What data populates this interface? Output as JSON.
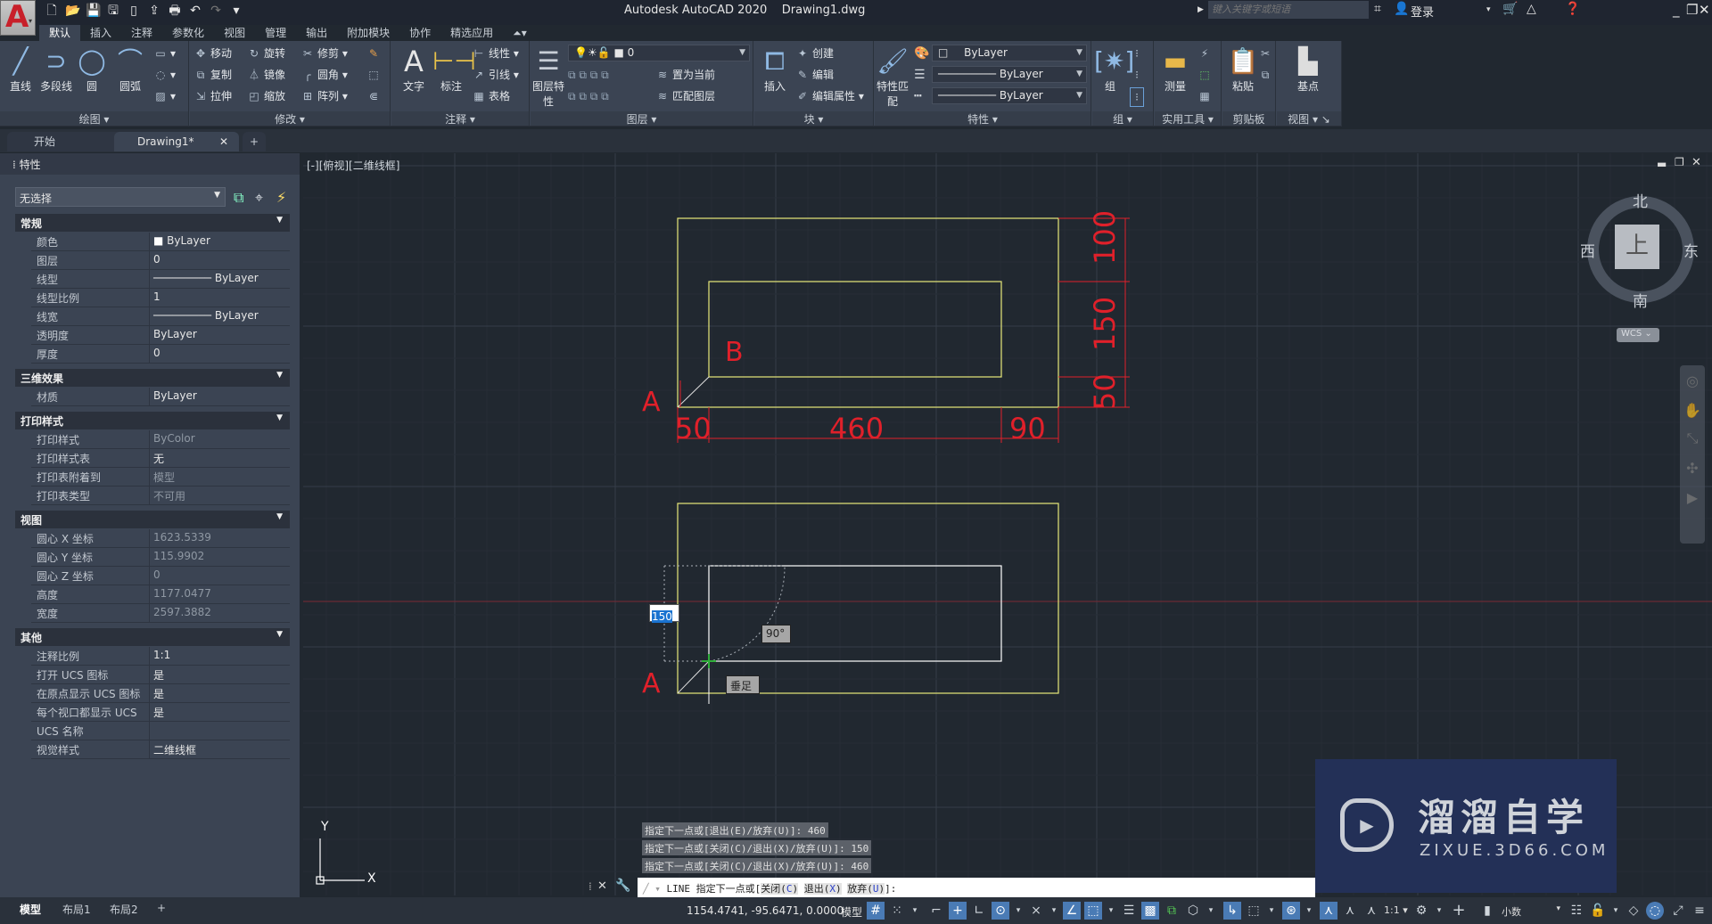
{
  "titlebar": {
    "app_logo": "A",
    "title": "Autodesk AutoCAD 2020    Drawing1.dwg",
    "search_placeholder": "键入关键字或短语",
    "login_label": "登录",
    "quick_access": [
      "new-icon",
      "open-icon",
      "save-icon",
      "save-as-icon",
      "open-web-icon",
      "save-web-icon",
      "plot-icon",
      "undo-icon",
      "redo-icon",
      "customize-icon"
    ]
  },
  "ribbon": {
    "tabs": [
      "默认",
      "插入",
      "注释",
      "参数化",
      "视图",
      "管理",
      "输出",
      "附加模块",
      "协作",
      "精选应用"
    ],
    "active_tab": "默认",
    "draw": {
      "title": "绘图",
      "line": "直线",
      "polyline": "多段线",
      "circle": "圆",
      "arc": "圆弧"
    },
    "modify": {
      "title": "修改",
      "move": "移动",
      "rotate": "旋转",
      "trim": "修剪",
      "copy": "复制",
      "mirror": "镜像",
      "fillet": "圆角",
      "stretch": "拉伸",
      "scale": "缩放",
      "array": "阵列"
    },
    "annotation": {
      "title": "注释",
      "text": "文字",
      "dimension": "标注",
      "linear": "线性",
      "leader": "引线",
      "table": "表格"
    },
    "layers": {
      "title": "图层",
      "layer_props": "图层特性",
      "layer_value": "0",
      "set_current": "置为当前",
      "match_layer": "匹配图层"
    },
    "block": {
      "title": "块",
      "insert": "插入",
      "create": "创建",
      "edit": "编辑",
      "edit_attr": "编辑属性"
    },
    "properties": {
      "title": "特性",
      "match": "特性匹配",
      "color": "ByLayer",
      "lineweight": "ByLayer",
      "linetype": "ByLayer"
    },
    "groups": {
      "title": "组",
      "group": "组"
    },
    "utilities": {
      "title": "实用工具",
      "measure": "测量"
    },
    "clipboard": {
      "title": "剪贴板",
      "paste": "粘贴"
    },
    "view": {
      "title": "视图",
      "base": "基点"
    }
  },
  "doc_tabs": {
    "start": "开始",
    "drawing": "Drawing1*"
  },
  "properties_panel": {
    "title": "特性",
    "selection": "无选择",
    "sections": [
      {
        "name": "常规",
        "rows": [
          {
            "k": "颜色",
            "v": "ByLayer"
          },
          {
            "k": "图层",
            "v": "0"
          },
          {
            "k": "线型",
            "v": "ByLayer"
          },
          {
            "k": "线型比例",
            "v": "1"
          },
          {
            "k": "线宽",
            "v": "ByLayer"
          },
          {
            "k": "透明度",
            "v": "ByLayer"
          },
          {
            "k": "厚度",
            "v": "0"
          }
        ]
      },
      {
        "name": "三维效果",
        "rows": [
          {
            "k": "材质",
            "v": "ByLayer"
          }
        ]
      },
      {
        "name": "打印样式",
        "rows": [
          {
            "k": "打印样式",
            "v": "ByColor"
          },
          {
            "k": "打印样式表",
            "v": "无"
          },
          {
            "k": "打印表附着到",
            "v": "模型"
          },
          {
            "k": "打印表类型",
            "v": "不可用"
          }
        ]
      },
      {
        "name": "视图",
        "rows": [
          {
            "k": "圆心 X 坐标",
            "v": "1623.5339"
          },
          {
            "k": "圆心 Y 坐标",
            "v": "115.9902"
          },
          {
            "k": "圆心 Z 坐标",
            "v": "0"
          },
          {
            "k": "高度",
            "v": "1177.0477"
          },
          {
            "k": "宽度",
            "v": "2597.3882"
          }
        ]
      },
      {
        "name": "其他",
        "rows": [
          {
            "k": "注释比例",
            "v": "1:1"
          },
          {
            "k": "打开 UCS 图标",
            "v": "是"
          },
          {
            "k": "在原点显示 UCS 图标",
            "v": "是"
          },
          {
            "k": "每个视口都显示 UCS",
            "v": "是"
          },
          {
            "k": "UCS 名称",
            "v": ""
          },
          {
            "k": "视觉样式",
            "v": "二维线框"
          }
        ]
      }
    ]
  },
  "viewport": {
    "label": "[-][俯视][二维线框]",
    "drawing_labels": {
      "a": "A",
      "b": "B"
    },
    "dimensions": {
      "d50_h": "50",
      "d460": "460",
      "d90": "90",
      "d100": "100",
      "d150": "150",
      "d50_v": "50"
    },
    "dynamic_input": "150",
    "angle_tooltip": "90°",
    "snap_tooltip": "垂足",
    "ucs": {
      "x": "X",
      "y": "Y"
    },
    "viewcube": {
      "north": "北",
      "south": "南",
      "east": "东",
      "west": "西",
      "top": "上",
      "wcs": "WCS"
    }
  },
  "command": {
    "history": [
      "指定下一点或[退出(E)/放弃(U)]: 460",
      "指定下一点或[关闭(C)/退出(X)/放弃(U)]: 150",
      "指定下一点或[关闭(C)/退出(X)/放弃(U)]: 460"
    ],
    "prompt_prefix": "LINE 指定下一点或[",
    "opt1": "关闭(",
    "opt1_key": "C",
    "opt1_end": ")",
    "opt2": "退出(",
    "opt2_key": "X",
    "opt2_end": ")",
    "opt3": "放弃(",
    "opt3_key": "U",
    "opt3_end": ")",
    "prompt_suffix": "]:"
  },
  "status": {
    "layout_tabs": [
      "模型",
      "布局1",
      "布局2"
    ],
    "coords": "1154.4741, -95.6471, 0.0000",
    "space": "模型",
    "scale": "1:1",
    "units": "小数"
  },
  "watermark": {
    "title": "溜溜自学",
    "url": "ZIXUE.3D66.COM"
  },
  "colors": {
    "accent": "#4a7bb5",
    "drawing_yellow": "#e8e87a",
    "dimension_red": "#e0202a",
    "canvas_bg": "#212830",
    "panel_bg": "#3b4453"
  }
}
